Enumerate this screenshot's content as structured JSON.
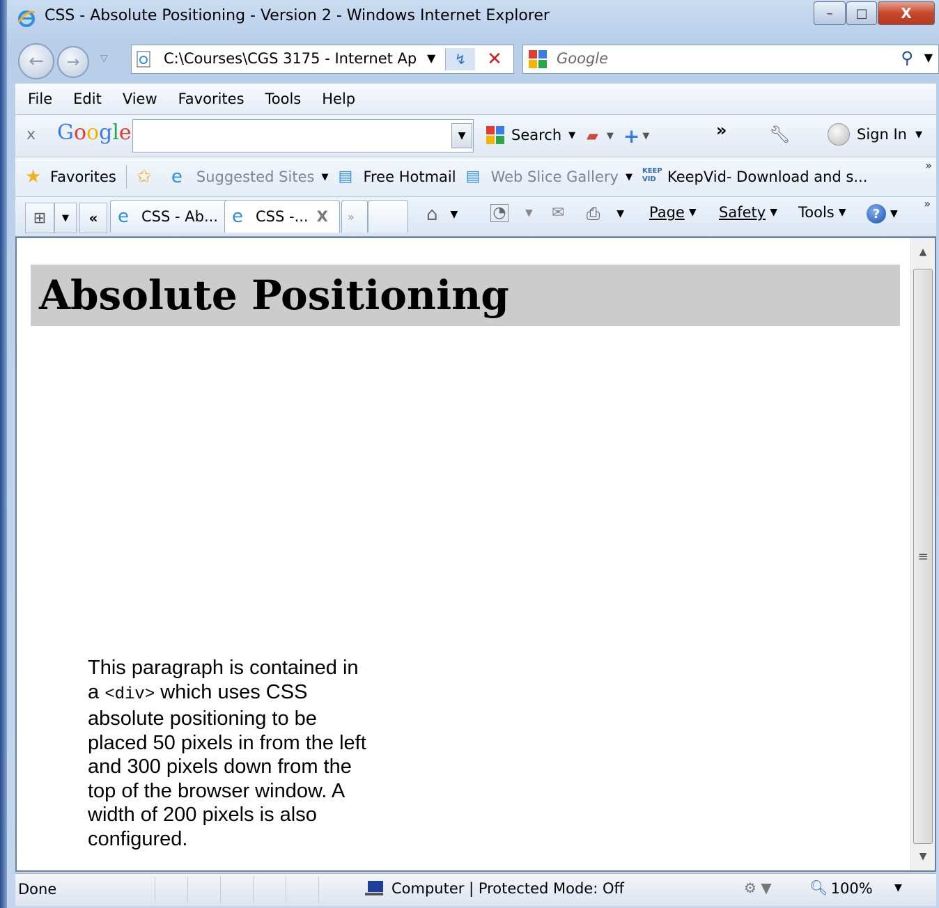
{
  "window": {
    "title": "CSS - Absolute Positioning - Version 2 - Windows Internet Explorer",
    "min_glyph": "–",
    "max_glyph": "□",
    "close_glyph": "X"
  },
  "nav": {
    "address": "C:\\Courses\\CGS 3175 - Internet Ap",
    "search_placeholder": "Google"
  },
  "menu": [
    "File",
    "Edit",
    "View",
    "Favorites",
    "Tools",
    "Help"
  ],
  "google_toolbar": {
    "close": "x",
    "logo": "Google",
    "search_label": "Search",
    "more": "»",
    "sign_in": "Sign In"
  },
  "favorites": {
    "label": "Favorites",
    "items": [
      {
        "label": "Suggested Sites",
        "dim": true
      },
      {
        "label": "Free Hotmail",
        "dim": false
      },
      {
        "label": "Web Slice Gallery",
        "dim": true
      },
      {
        "label": "KeepVid- Download and s...",
        "dim": false
      }
    ],
    "overflow": "»"
  },
  "tabs": {
    "back_chevrons": "«",
    "tab1": "CSS - Ab...",
    "tab2": "CSS -...",
    "tab2_close": "X",
    "new_tab": "»"
  },
  "commands": {
    "page": "Page",
    "safety": "Safety",
    "tools": "Tools"
  },
  "page": {
    "heading": "Absolute Positioning",
    "para_1": "This paragraph is contained in a",
    "para_code": "<div>",
    "para_2": "which uses CSS absolute positioning to be placed 50 pixels in from the left and 300 pixels down from the top of the browser window. A width of 200 pixels is also configured."
  },
  "status": {
    "text": "Done",
    "zone": "Computer | Protected Mode: Off",
    "zoom": "100%"
  }
}
